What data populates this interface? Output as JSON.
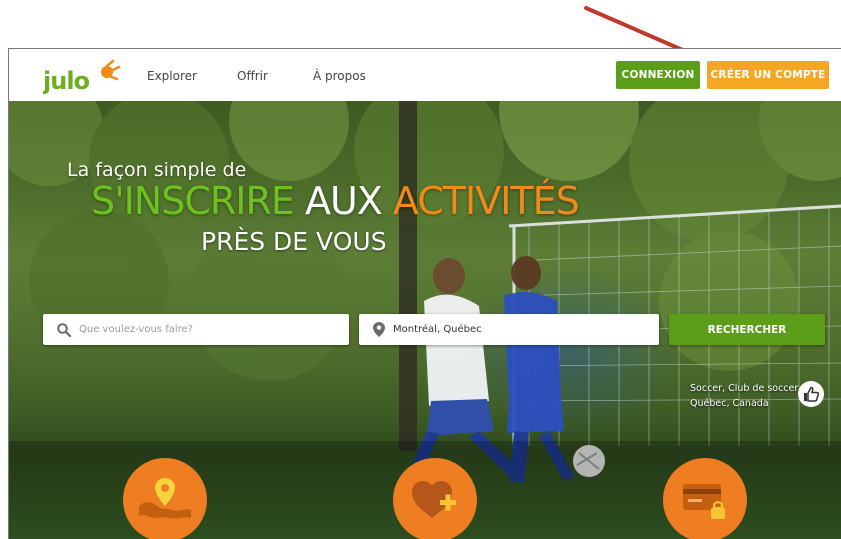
{
  "header": {
    "nav": [
      "Explorer",
      "Offrir",
      "À propos"
    ],
    "connexion_label": "CONNEXION",
    "creer_label": "CRÉER UN COMPTE"
  },
  "hero": {
    "line1": "La façon simple de",
    "line2_word1": "S'INSCRIRE",
    "line2_word2": "AUX",
    "line2_word3": "ACTIVITÉS",
    "line3": "PRÈS DE VOUS"
  },
  "search": {
    "what_placeholder": "Que voulez-vous faire?",
    "where_value": "Montréal, Québec",
    "button_label": "RECHERCHER"
  },
  "photo_credit": {
    "line1": "Soccer, Club de soccer",
    "line2": "Québec, Canada"
  },
  "colors": {
    "brand_green": "#5c9e1a",
    "brand_orange": "#f5a623",
    "accent_orange": "#ee7e21",
    "annotation_arrow": "#c0392b"
  },
  "icons": [
    "search-icon",
    "location-pin-icon",
    "thumbs-up-icon",
    "map-pin-world-icon",
    "heart-plus-icon",
    "secure-card-icon"
  ]
}
